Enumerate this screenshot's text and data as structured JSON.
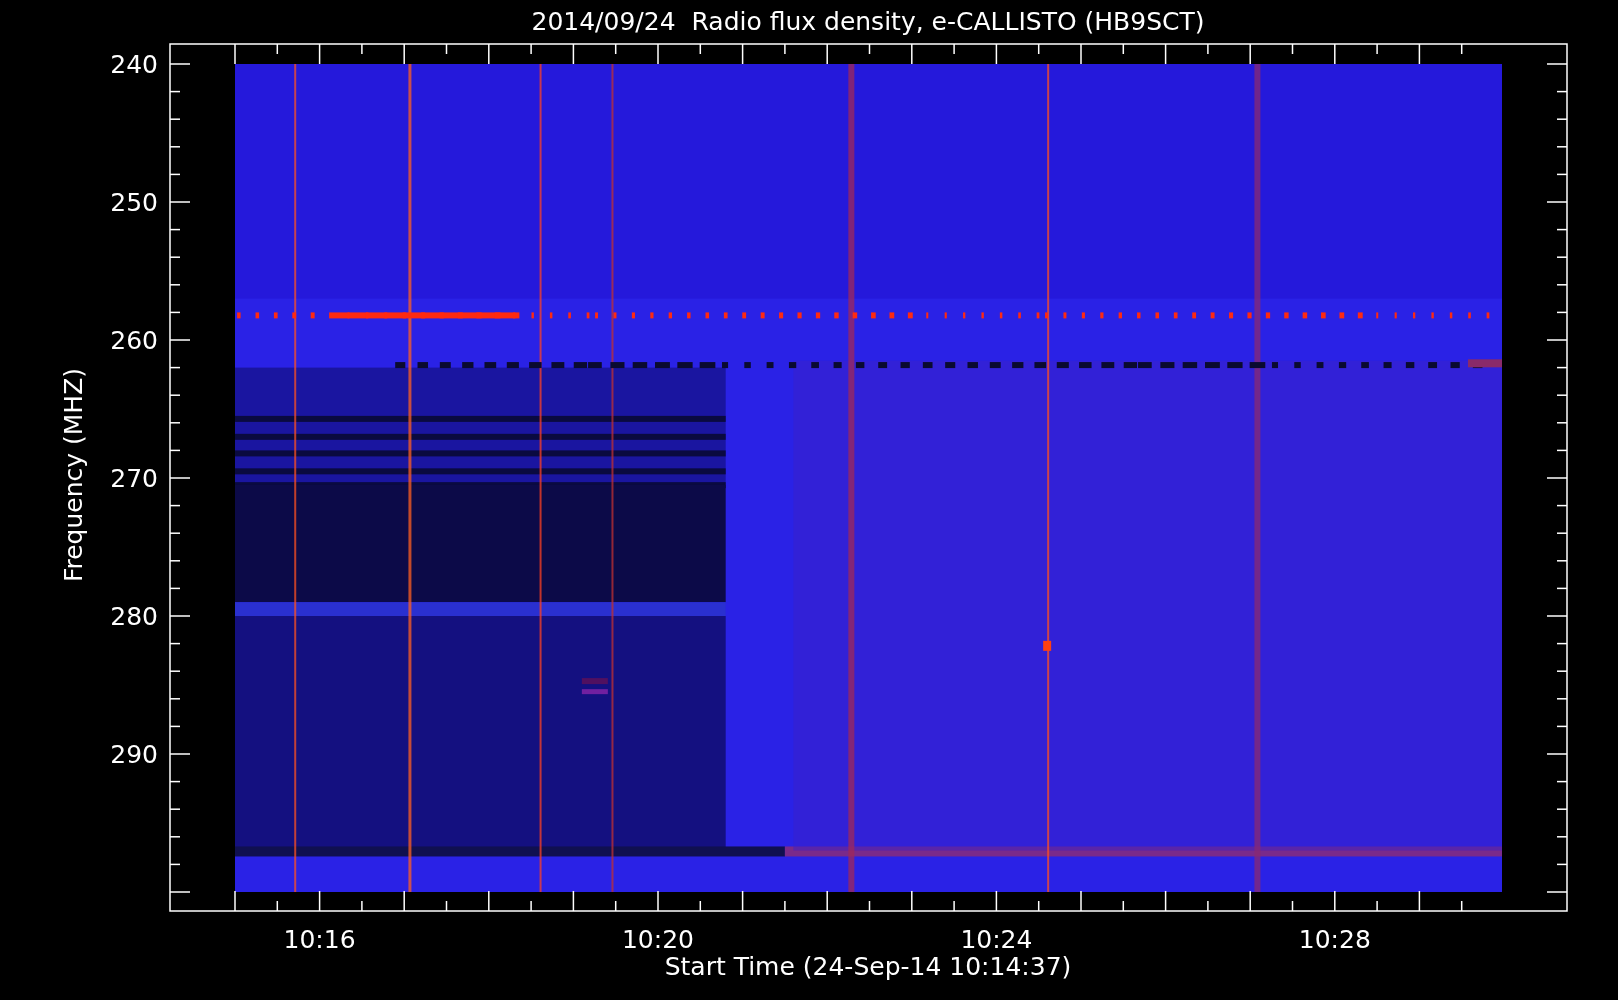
{
  "title": "2014/09/24  Radio flux density, e-CALLISTO (HB9SCT)",
  "y_axis": {
    "label": "Frequency (MHZ)",
    "ticks": [
      "240",
      "250",
      "260",
      "270",
      "280",
      "290"
    ]
  },
  "x_axis": {
    "label": "Start Time (24-Sep-14 10:14:37)",
    "ticks": [
      "10:16",
      "10:20",
      "10:24",
      "10:28"
    ]
  }
}
